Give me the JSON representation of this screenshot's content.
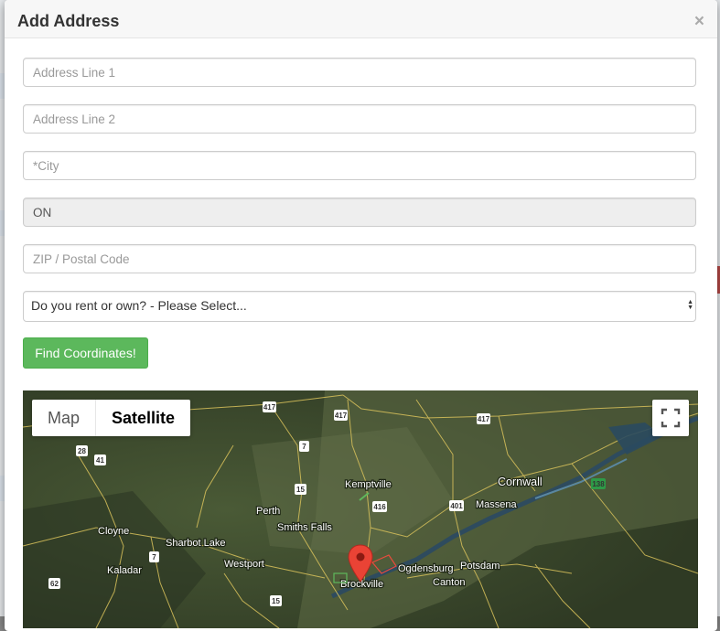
{
  "modal": {
    "title": "Add Address",
    "close": "×"
  },
  "form": {
    "address1_placeholder": "Address Line 1",
    "address2_placeholder": "Address Line 2",
    "city_placeholder": "*City",
    "province_value": "ON",
    "postal_placeholder": "ZIP / Postal Code",
    "rent_own_selected": "Do you rent or own? - Please Select...",
    "find_button": "Find Coordinates!"
  },
  "map": {
    "type_map": "Map",
    "type_satellite": "Satellite",
    "selected_type": "Satellite",
    "places": [
      "Kemptville",
      "Cornwall",
      "Massena",
      "Perth",
      "Smiths Falls",
      "Cloyne",
      "Sharbot Lake",
      "Westport",
      "Kaladar",
      "Ogdensburg",
      "Potsdam",
      "Canton",
      "Brockville"
    ],
    "route_shields": [
      "417",
      "417",
      "417",
      "28",
      "41",
      "7",
      "15",
      "416",
      "401",
      "138",
      "7",
      "62",
      "15"
    ],
    "icons": {
      "fullscreen": "fullscreen-icon",
      "marker": "map-marker-icon"
    },
    "colors": {
      "marker": "#ea4335",
      "highway_shield": "#2e9a47"
    }
  }
}
